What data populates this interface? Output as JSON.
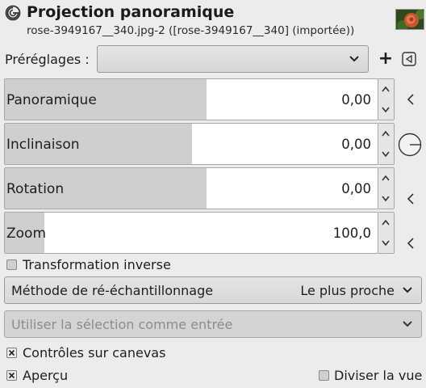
{
  "header": {
    "title": "Projection panoramique",
    "subtitle": "rose-3949167__340.jpg-2 ([rose-3949167__340] (importée))"
  },
  "presets": {
    "label": "Préréglages :",
    "value": "",
    "add_label": "+"
  },
  "params": [
    {
      "label": "Panoramique",
      "value": "0,00",
      "fill_fraction": 0.54
    },
    {
      "label": "Inclinaison",
      "value": "0,00",
      "fill_fraction": 0.5
    },
    {
      "label": "Rotation",
      "value": "0,00",
      "fill_fraction": 0.54
    },
    {
      "label": "Zoom",
      "value": "100,0",
      "fill_fraction": 0.1
    }
  ],
  "inverse_transform": {
    "label": "Transformation inverse",
    "checked": false
  },
  "resampling": {
    "label": "Méthode de ré-échantillonnage",
    "value": "Le plus proche"
  },
  "use_selection": {
    "label": "Utiliser la sélection comme entrée",
    "enabled": false
  },
  "canvas_controls": {
    "label": "Contrôles sur canevas",
    "checked": true
  },
  "preview": {
    "label": "Aperçu",
    "checked": true
  },
  "split_view": {
    "label": "Diviser la vue",
    "checked": false
  },
  "icons": {
    "app": "gegl-icon",
    "thumbnail": "image-thumbnail",
    "preset_menu": "preset-menu-icon",
    "dial": "angle-dial-icon",
    "reset": "reset-arrow-icon"
  },
  "colors": {
    "background": "#ececec",
    "fill": "#cfcfcf",
    "field": "#ffffff"
  }
}
